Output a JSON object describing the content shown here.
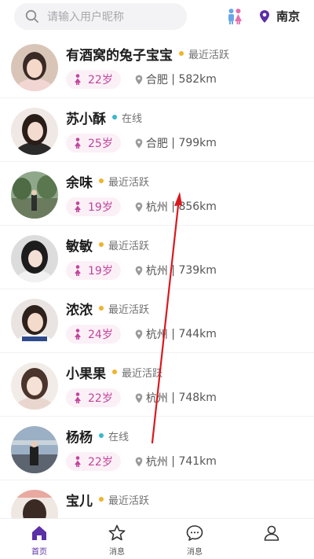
{
  "header": {
    "search_placeholder": "请输入用户昵称",
    "city": "南京"
  },
  "colors": {
    "accent": "#5b2fa6",
    "age_pill_bg": "#fcf0f7",
    "age_text": "#c0459b",
    "status_recent": "#f0b429",
    "status_online": "#3ab7c9",
    "annotation_arrow": "#d9191f"
  },
  "users": [
    {
      "name": "有酒窝的兔子宝宝",
      "status": "最近活跃",
      "status_type": "recent",
      "age": "22岁",
      "city": "合肥",
      "distance": "582km"
    },
    {
      "name": "苏小酥",
      "status": "在线",
      "status_type": "online",
      "age": "25岁",
      "city": "合肥",
      "distance": "799km"
    },
    {
      "name": "余味",
      "status": "最近活跃",
      "status_type": "recent",
      "age": "19岁",
      "city": "杭州",
      "distance": "856km"
    },
    {
      "name": "敏敏",
      "status": "最近活跃",
      "status_type": "recent",
      "age": "19岁",
      "city": "杭州",
      "distance": "739km"
    },
    {
      "name": "浓浓",
      "status": "最近活跃",
      "status_type": "recent",
      "age": "24岁",
      "city": "杭州",
      "distance": "744km"
    },
    {
      "name": "小果果",
      "status": "最近活跃",
      "status_type": "recent",
      "age": "22岁",
      "city": "杭州",
      "distance": "748km"
    },
    {
      "name": "杨杨",
      "status": "在线",
      "status_type": "online",
      "age": "22岁",
      "city": "杭州",
      "distance": "741km"
    },
    {
      "name": "宝儿",
      "status": "最近活跃",
      "status_type": "recent",
      "age": "",
      "city": "",
      "distance": ""
    }
  ],
  "tabbar": {
    "items": [
      {
        "label": "首页",
        "icon": "home-icon",
        "active": true
      },
      {
        "label": "消息",
        "icon": "star-icon",
        "active": false
      },
      {
        "label": "消息",
        "icon": "chat-bubble-icon",
        "active": false
      },
      {
        "label": "",
        "icon": "profile-icon",
        "active": false
      }
    ]
  }
}
